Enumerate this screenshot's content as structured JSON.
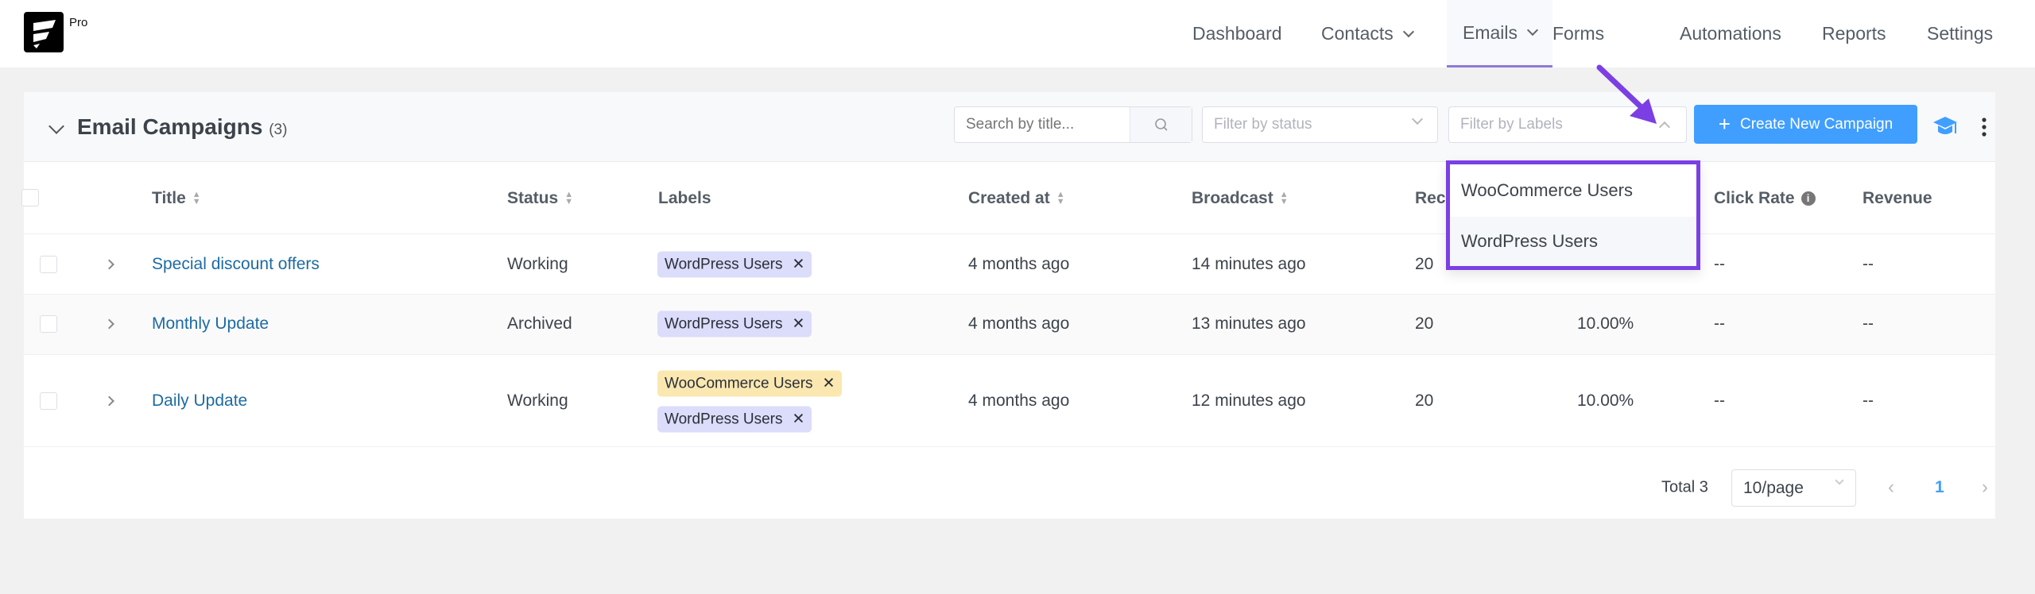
{
  "app": {
    "badge": "Pro"
  },
  "nav": [
    {
      "label": "Dashboard"
    },
    {
      "label": "Contacts",
      "dropdown": true
    },
    {
      "label": "Emails",
      "dropdown": true,
      "active": true
    },
    {
      "label": "Forms"
    },
    {
      "label": "Automations"
    },
    {
      "label": "Reports"
    },
    {
      "label": "Settings"
    }
  ],
  "panel": {
    "title": "Email Campaigns",
    "count": "(3)"
  },
  "toolbar": {
    "search_placeholder": "Search by title...",
    "status_placeholder": "Filter by status",
    "labels_placeholder": "Filter by Labels",
    "create_label": "Create New Campaign"
  },
  "columns": {
    "title": "Title",
    "status": "Status",
    "labels": "Labels",
    "created": "Created at",
    "broadcast": "Broadcast",
    "recipients": "Rec",
    "click_rate": "Click Rate",
    "revenue": "Revenue"
  },
  "rows": [
    {
      "title": "Special discount offers",
      "status": "Working",
      "labels": [
        "WordPress Users"
      ],
      "created": "4 months ago",
      "broadcast": "14 minutes ago",
      "recipients": "20",
      "open_rate": "",
      "click_rate": "--",
      "revenue": "--"
    },
    {
      "title": "Monthly Update",
      "status": "Archived",
      "labels": [
        "WordPress Users"
      ],
      "created": "4 months ago",
      "broadcast": "13 minutes ago",
      "recipients": "20",
      "open_rate": "10.00%",
      "click_rate": "--",
      "revenue": "--"
    },
    {
      "title": "Daily Update",
      "status": "Working",
      "labels": [
        "WooCommerce Users",
        "WordPress Users"
      ],
      "created": "4 months ago",
      "broadcast": "12 minutes ago",
      "recipients": "20",
      "open_rate": "10.00%",
      "click_rate": "--",
      "revenue": "--"
    }
  ],
  "dropdown": {
    "options": [
      "WooCommerce Users",
      "WordPress Users"
    ],
    "hovered": "WordPress Users"
  },
  "pagination": {
    "total": "Total 3",
    "page_size": "10/page",
    "current": "1"
  },
  "colors": {
    "accent": "#409eff",
    "highlight": "#7b3fe4",
    "tag_wordpress": "#dcdcfb",
    "tag_woocommerce": "#fbe8b0",
    "link": "#1d6ba3"
  }
}
